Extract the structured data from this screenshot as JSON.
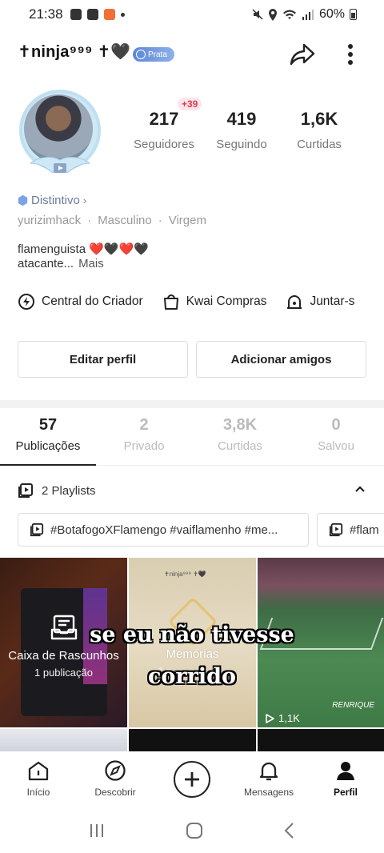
{
  "status_bar": {
    "time": "21:38",
    "battery": "60%"
  },
  "header": {
    "username": "✝ninja⁹⁹⁹ ✝🖤",
    "badge": "Prata"
  },
  "profile": {
    "stats": [
      {
        "value": "217",
        "label": "Seguidores"
      },
      {
        "value": "419",
        "label": "Seguindo"
      },
      {
        "value": "1,6K",
        "label": "Curtidas"
      }
    ],
    "new_followers": "+39",
    "distintivo": "Distintivo",
    "meta": [
      "yurizimhack",
      "·",
      "Masculino",
      "·",
      "Virgem"
    ],
    "bio_line1": "flamenguista ❤️🖤❤️🖤",
    "bio_line2": "atacante...",
    "bio_more": "Mais"
  },
  "quick_links": [
    {
      "label": "Central do Criador",
      "icon": "bolt-circle-icon"
    },
    {
      "label": "Kwai Compras",
      "icon": "shopping-bag-icon"
    },
    {
      "label": "Juntar-s",
      "icon": "home-icon"
    }
  ],
  "buttons": {
    "edit": "Editar perfil",
    "add_friends": "Adicionar amigos"
  },
  "tabs": [
    {
      "count": "57",
      "label": "Publicações",
      "active": true
    },
    {
      "count": "2",
      "label": "Privado"
    },
    {
      "count": "3,8K",
      "label": "Curtidas"
    },
    {
      "count": "0",
      "label": "Salvou"
    }
  ],
  "playlists": {
    "header": "2 Playlists",
    "items": [
      "#BotafogoXFlamengo #vaiflamenho #me...",
      "#flam"
    ]
  },
  "grid": {
    "drafts_title": "Caixa de Rascunhos",
    "drafts_sub": "1 publicação",
    "memories_title": "Memórias",
    "memories_sub": "1 p",
    "video_views": "1,1K",
    "video_brand": "RENRIQUE",
    "caption_line1": "se eu não tivesse",
    "caption_line2": "corrido"
  },
  "bottom_nav": [
    {
      "label": "Início",
      "icon": "home-outline-icon"
    },
    {
      "label": "Descobrir",
      "icon": "compass-icon"
    },
    {
      "label": "",
      "icon": "plus-icon"
    },
    {
      "label": "Mensagens",
      "icon": "bell-icon"
    },
    {
      "label": "Perfil",
      "icon": "person-icon",
      "active": true
    }
  ],
  "colors": {
    "accent_red": "#e03a4f",
    "badge_blue": "#5a87d8",
    "muted_text": "#999999"
  }
}
